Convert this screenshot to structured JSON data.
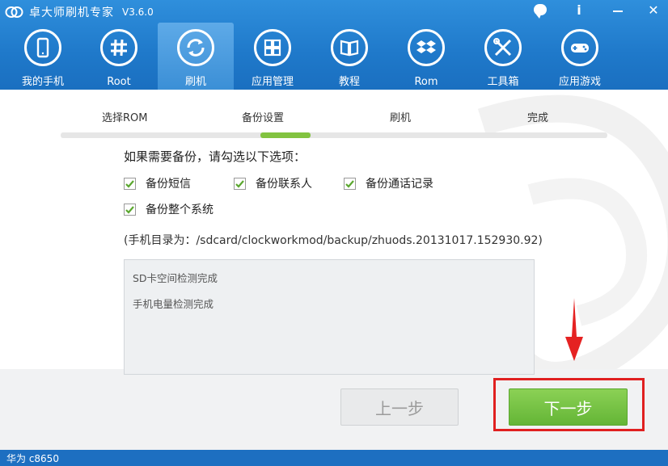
{
  "app": {
    "title": "卓大师刷机专家",
    "version": "V3.6.0"
  },
  "window_controls": {
    "chat_icon": "chat-bubble-icon",
    "info_label": "i",
    "minimize_icon": "minimize-icon",
    "close_label": "✕"
  },
  "nav": {
    "items": [
      {
        "label": "我的手机",
        "icon": "phone-icon"
      },
      {
        "label": "Root",
        "icon": "hash-icon"
      },
      {
        "label": "刷机",
        "icon": "refresh-icon",
        "active": true
      },
      {
        "label": "应用管理",
        "icon": "grid-icon"
      },
      {
        "label": "教程",
        "icon": "book-icon"
      },
      {
        "label": "Rom",
        "icon": "box-icon"
      },
      {
        "label": "工具箱",
        "icon": "tools-icon"
      },
      {
        "label": "应用游戏",
        "icon": "gamepad-icon"
      }
    ]
  },
  "steps": {
    "items": [
      "选择ROM",
      "备份设置",
      "刷机",
      "完成"
    ],
    "active_index": 1
  },
  "backup": {
    "prompt": "如果需要备份，请勾选以下选项：",
    "options": [
      {
        "label": "备份短信",
        "checked": true
      },
      {
        "label": "备份联系人",
        "checked": true
      },
      {
        "label": "备份通话记录",
        "checked": true
      },
      {
        "label": "备份整个系统",
        "checked": true
      }
    ],
    "path_text": "(手机目录为：/sdcard/clockworkmod/backup/zhuods.20131017.152930.92)"
  },
  "log": {
    "lines": [
      "SD卡空间检测完成",
      "手机电量检测完成"
    ]
  },
  "buttons": {
    "prev_label": "上一步",
    "next_label": "下一步"
  },
  "status": {
    "device": "华为 c8650"
  },
  "colors": {
    "header_blue": "#1f79ca",
    "accent_green": "#64b536",
    "highlight_red": "#e02020"
  }
}
